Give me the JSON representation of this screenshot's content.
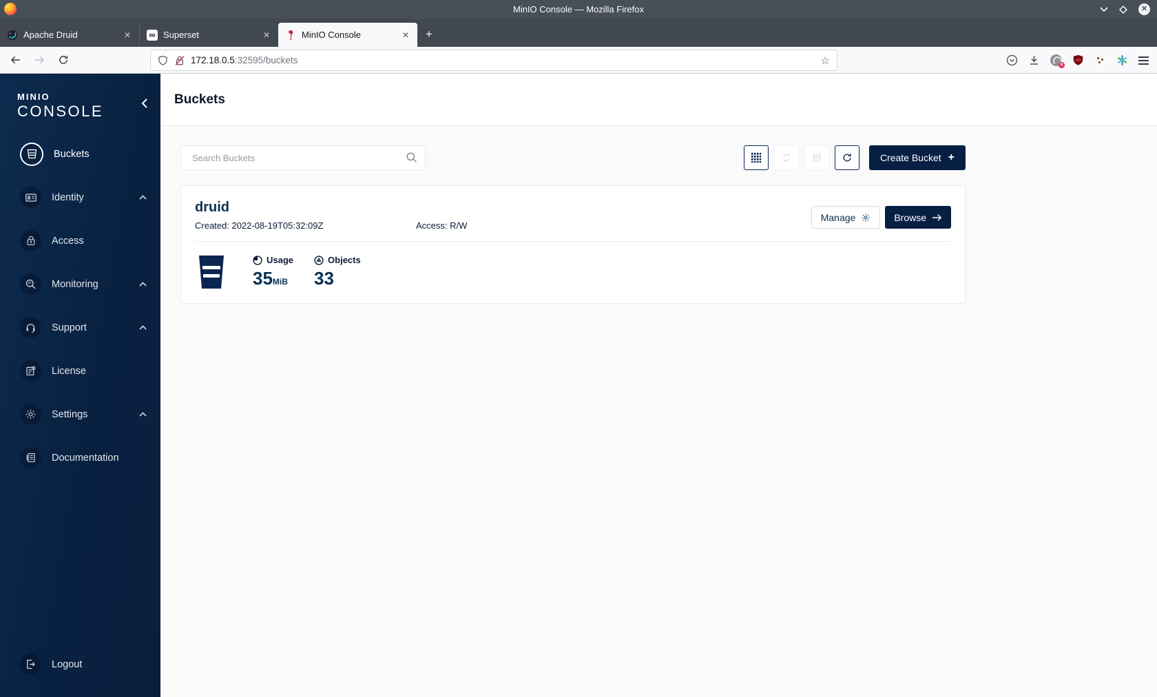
{
  "window": {
    "title": "MinIO Console — Mozilla Firefox"
  },
  "browser": {
    "tabs": [
      {
        "label": "Apache Druid",
        "favicon": "druid-icon",
        "active": false
      },
      {
        "label": "Superset",
        "favicon": "superset-icon",
        "active": false
      },
      {
        "label": "MinIO Console",
        "favicon": "minio-flamingo-icon",
        "active": true
      }
    ],
    "url": {
      "host": "172.18.0.5",
      "path": ":32595/buckets"
    }
  },
  "sidebar": {
    "logo": {
      "line1": "MINIO",
      "line2": "CONSOLE"
    },
    "items": [
      {
        "label": "Buckets",
        "icon": "bucket-icon",
        "active": true,
        "expandable": false
      },
      {
        "label": "Identity",
        "icon": "identity-card-icon",
        "active": false,
        "expandable": true
      },
      {
        "label": "Access",
        "icon": "access-lock-icon",
        "active": false,
        "expandable": false
      },
      {
        "label": "Monitoring",
        "icon": "monitoring-search-icon",
        "active": false,
        "expandable": true
      },
      {
        "label": "Support",
        "icon": "support-headset-icon",
        "active": false,
        "expandable": true
      },
      {
        "label": "License",
        "icon": "license-doc-icon",
        "active": false,
        "expandable": false
      },
      {
        "label": "Settings",
        "icon": "gear-icon",
        "active": false,
        "expandable": true
      },
      {
        "label": "Documentation",
        "icon": "documentation-book-icon",
        "active": false,
        "expandable": false
      }
    ],
    "logout": {
      "label": "Logout",
      "icon": "logout-icon"
    }
  },
  "page": {
    "title": "Buckets"
  },
  "bucket_toolbar": {
    "search_placeholder": "Search Buckets",
    "create_button_label": "Create Bucket"
  },
  "bucket_card": {
    "name": "druid",
    "created": "Created: 2022-08-19T05:32:09Z",
    "access": "Access: R/W",
    "manage_label": "Manage",
    "browse_label": "Browse",
    "usage_label": "Usage",
    "usage_value": "35",
    "usage_unit": "MiB",
    "objects_label": "Objects",
    "objects_value": "33"
  },
  "colors": {
    "primary_navy": "#081F44",
    "sidebar_gradient_start": "#0D2B4E",
    "sidebar_gradient_end": "#0A1F3E",
    "titlebar_grey": "#474F58",
    "content_bg": "#FAFAFA",
    "minio_red": "#C72C48"
  }
}
